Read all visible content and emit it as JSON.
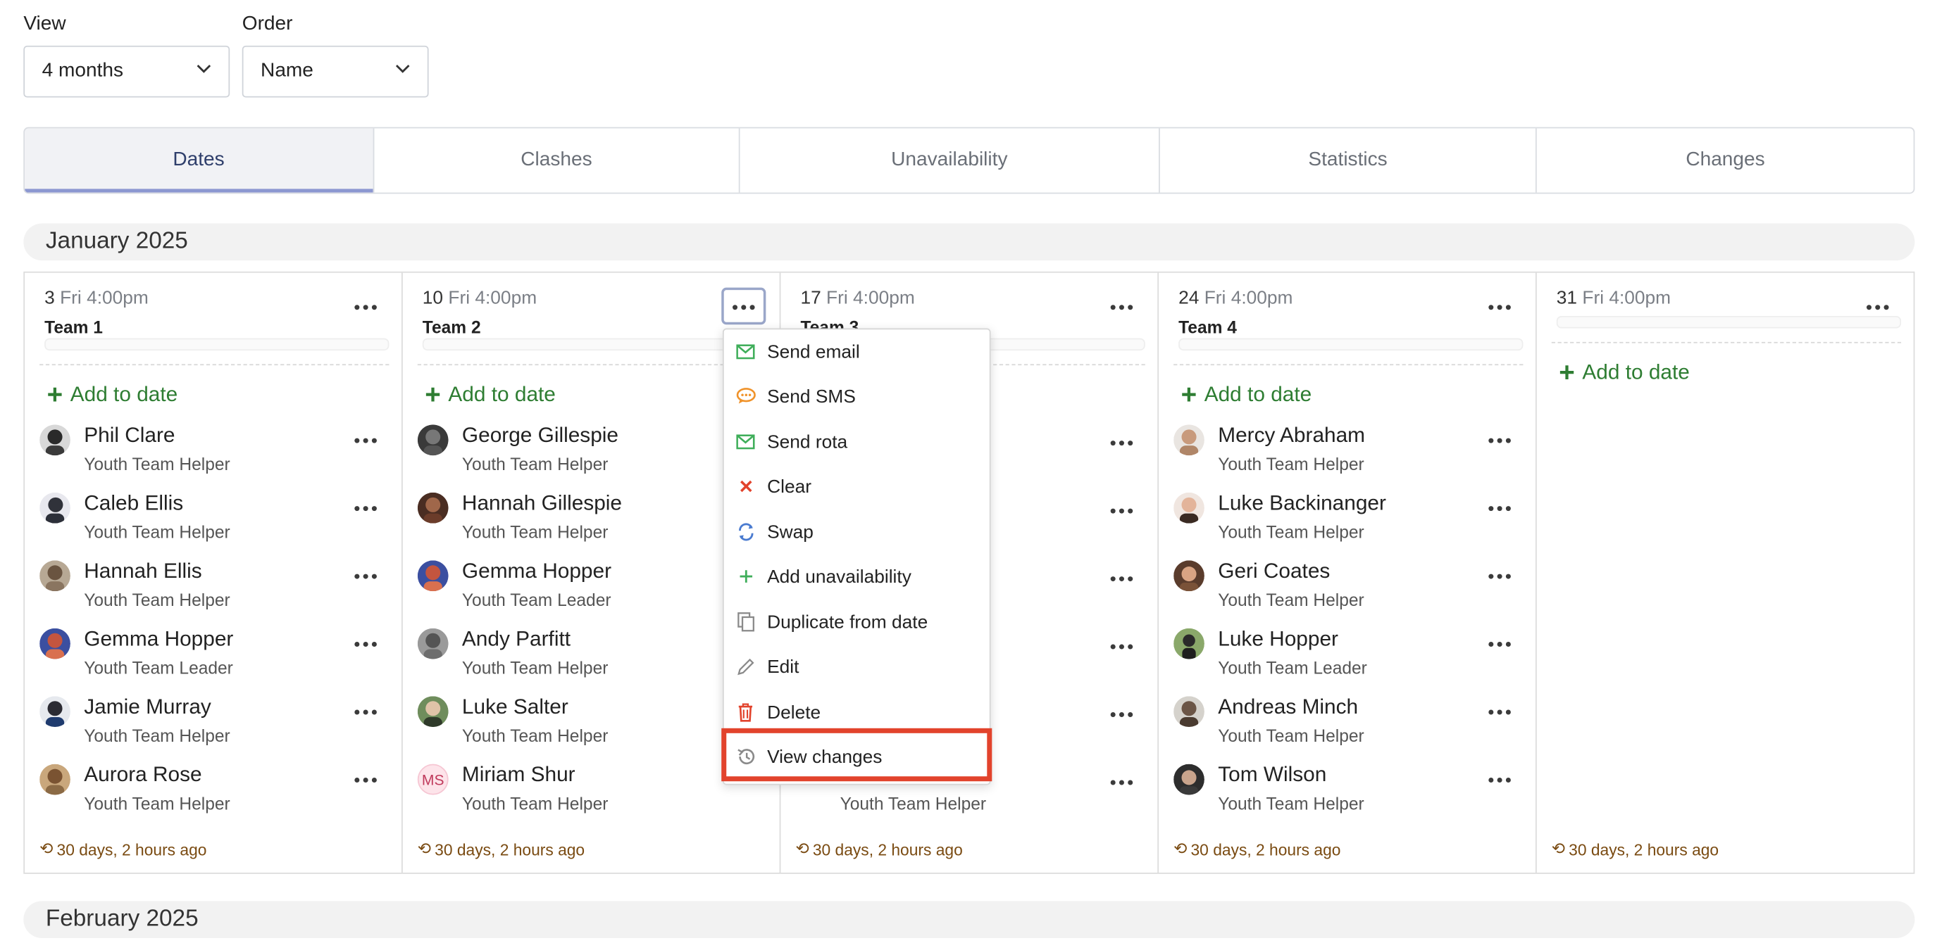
{
  "filters": {
    "view": {
      "label": "View",
      "value": "4 months"
    },
    "order": {
      "label": "Order",
      "value": "Name"
    }
  },
  "tabs": [
    "Dates",
    "Clashes",
    "Unavailability",
    "Statistics",
    "Changes"
  ],
  "months": {
    "january": "January 2025",
    "february": "February 2025"
  },
  "add_label": "Add to date",
  "columns": [
    {
      "day": "3",
      "time": "Fri 4:00pm",
      "team": "Team 1",
      "ago": "30 days, 2 hours ago",
      "people": [
        {
          "name": "Phil Clare",
          "role": "Youth Team Helper"
        },
        {
          "name": "Caleb Ellis",
          "role": "Youth Team Helper"
        },
        {
          "name": "Hannah Ellis",
          "role": "Youth Team Helper"
        },
        {
          "name": "Gemma Hopper",
          "role": "Youth Team Leader"
        },
        {
          "name": "Jamie Murray",
          "role": "Youth Team Helper"
        },
        {
          "name": "Aurora Rose",
          "role": "Youth Team Helper"
        }
      ]
    },
    {
      "day": "10",
      "time": "Fri 4:00pm",
      "team": "Team 2",
      "ago": "30 days, 2 hours ago",
      "people": [
        {
          "name": "George Gillespie",
          "role": "Youth Team Helper"
        },
        {
          "name": "Hannah Gillespie",
          "role": "Youth Team Helper"
        },
        {
          "name": "Gemma Hopper",
          "role": "Youth Team Leader"
        },
        {
          "name": "Andy Parfitt",
          "role": "Youth Team Helper"
        },
        {
          "name": "Luke Salter",
          "role": "Youth Team Helper"
        },
        {
          "name": "Miriam Shur",
          "role": "Youth Team Helper",
          "initials": "MS"
        }
      ]
    },
    {
      "day": "17",
      "time": "Fri 4:00pm",
      "team": "Team 3",
      "ago": "30 days, 2 hours ago",
      "last_role": "Youth Team Helper"
    },
    {
      "day": "24",
      "time": "Fri 4:00pm",
      "team": "Team 4",
      "ago": "30 days, 2 hours ago",
      "people": [
        {
          "name": "Mercy Abraham",
          "role": "Youth Team Helper"
        },
        {
          "name": "Luke Backinanger",
          "role": "Youth Team Helper"
        },
        {
          "name": "Geri Coates",
          "role": "Youth Team Helper"
        },
        {
          "name": "Luke Hopper",
          "role": "Youth Team Leader"
        },
        {
          "name": "Andreas Minch",
          "role": "Youth Team Helper"
        },
        {
          "name": "Tom Wilson",
          "role": "Youth Team Helper"
        }
      ]
    },
    {
      "day": "31",
      "time": "Fri 4:00pm",
      "team": "",
      "ago": "30 days, 2 hours ago"
    }
  ],
  "menu": [
    {
      "label": "Send email",
      "icon": "envelope-icon",
      "color": "#3fae5a"
    },
    {
      "label": "Send SMS",
      "icon": "chat-bubble-icon",
      "color": "#f0932b"
    },
    {
      "label": "Send rota",
      "icon": "envelope-icon",
      "color": "#3fae5a"
    },
    {
      "label": "Clear",
      "icon": "close-icon",
      "color": "#e2432c"
    },
    {
      "label": "Swap",
      "icon": "swap-icon",
      "color": "#4a7bd0"
    },
    {
      "label": "Add unavailability",
      "icon": "plus-icon",
      "color": "#3fae5a"
    },
    {
      "label": "Duplicate from date",
      "icon": "copy-icon",
      "color": "#8a8a8a"
    },
    {
      "label": "Edit",
      "icon": "pencil-icon",
      "color": "#8a8a8a"
    },
    {
      "label": "Delete",
      "icon": "trash-icon",
      "color": "#e2432c"
    },
    {
      "label": "View changes",
      "icon": "history-icon",
      "color": "#8a8a8a"
    }
  ],
  "colors": {
    "accent_green": "#2e7d32",
    "highlight": "#e2432c",
    "tab_active": "#2f3f6b"
  }
}
